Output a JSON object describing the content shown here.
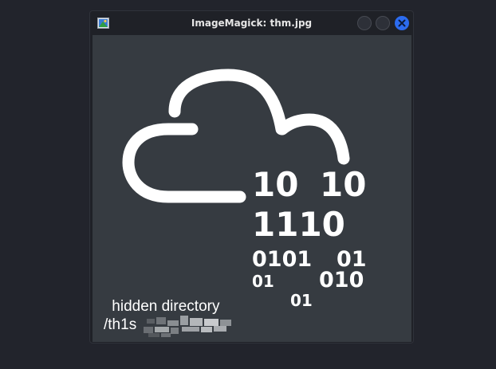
{
  "window": {
    "title": "ImageMagick: thm.jpg",
    "icons": [
      "imagemagick-app-icon",
      "minimize-icon",
      "maximize-icon",
      "close-icon"
    ]
  },
  "image": {
    "binary_lines": [
      "10",
      "10",
      "1110",
      "0101",
      "01",
      "01",
      "010",
      "01"
    ],
    "caption_line1": " hidden directory",
    "caption_line2": "/th1s"
  },
  "colors": {
    "desktop": "#22242c",
    "window": "#1f2127",
    "image_bg": "#363b41",
    "close_button": "#2c6cf0",
    "foreground": "#ffffff"
  }
}
